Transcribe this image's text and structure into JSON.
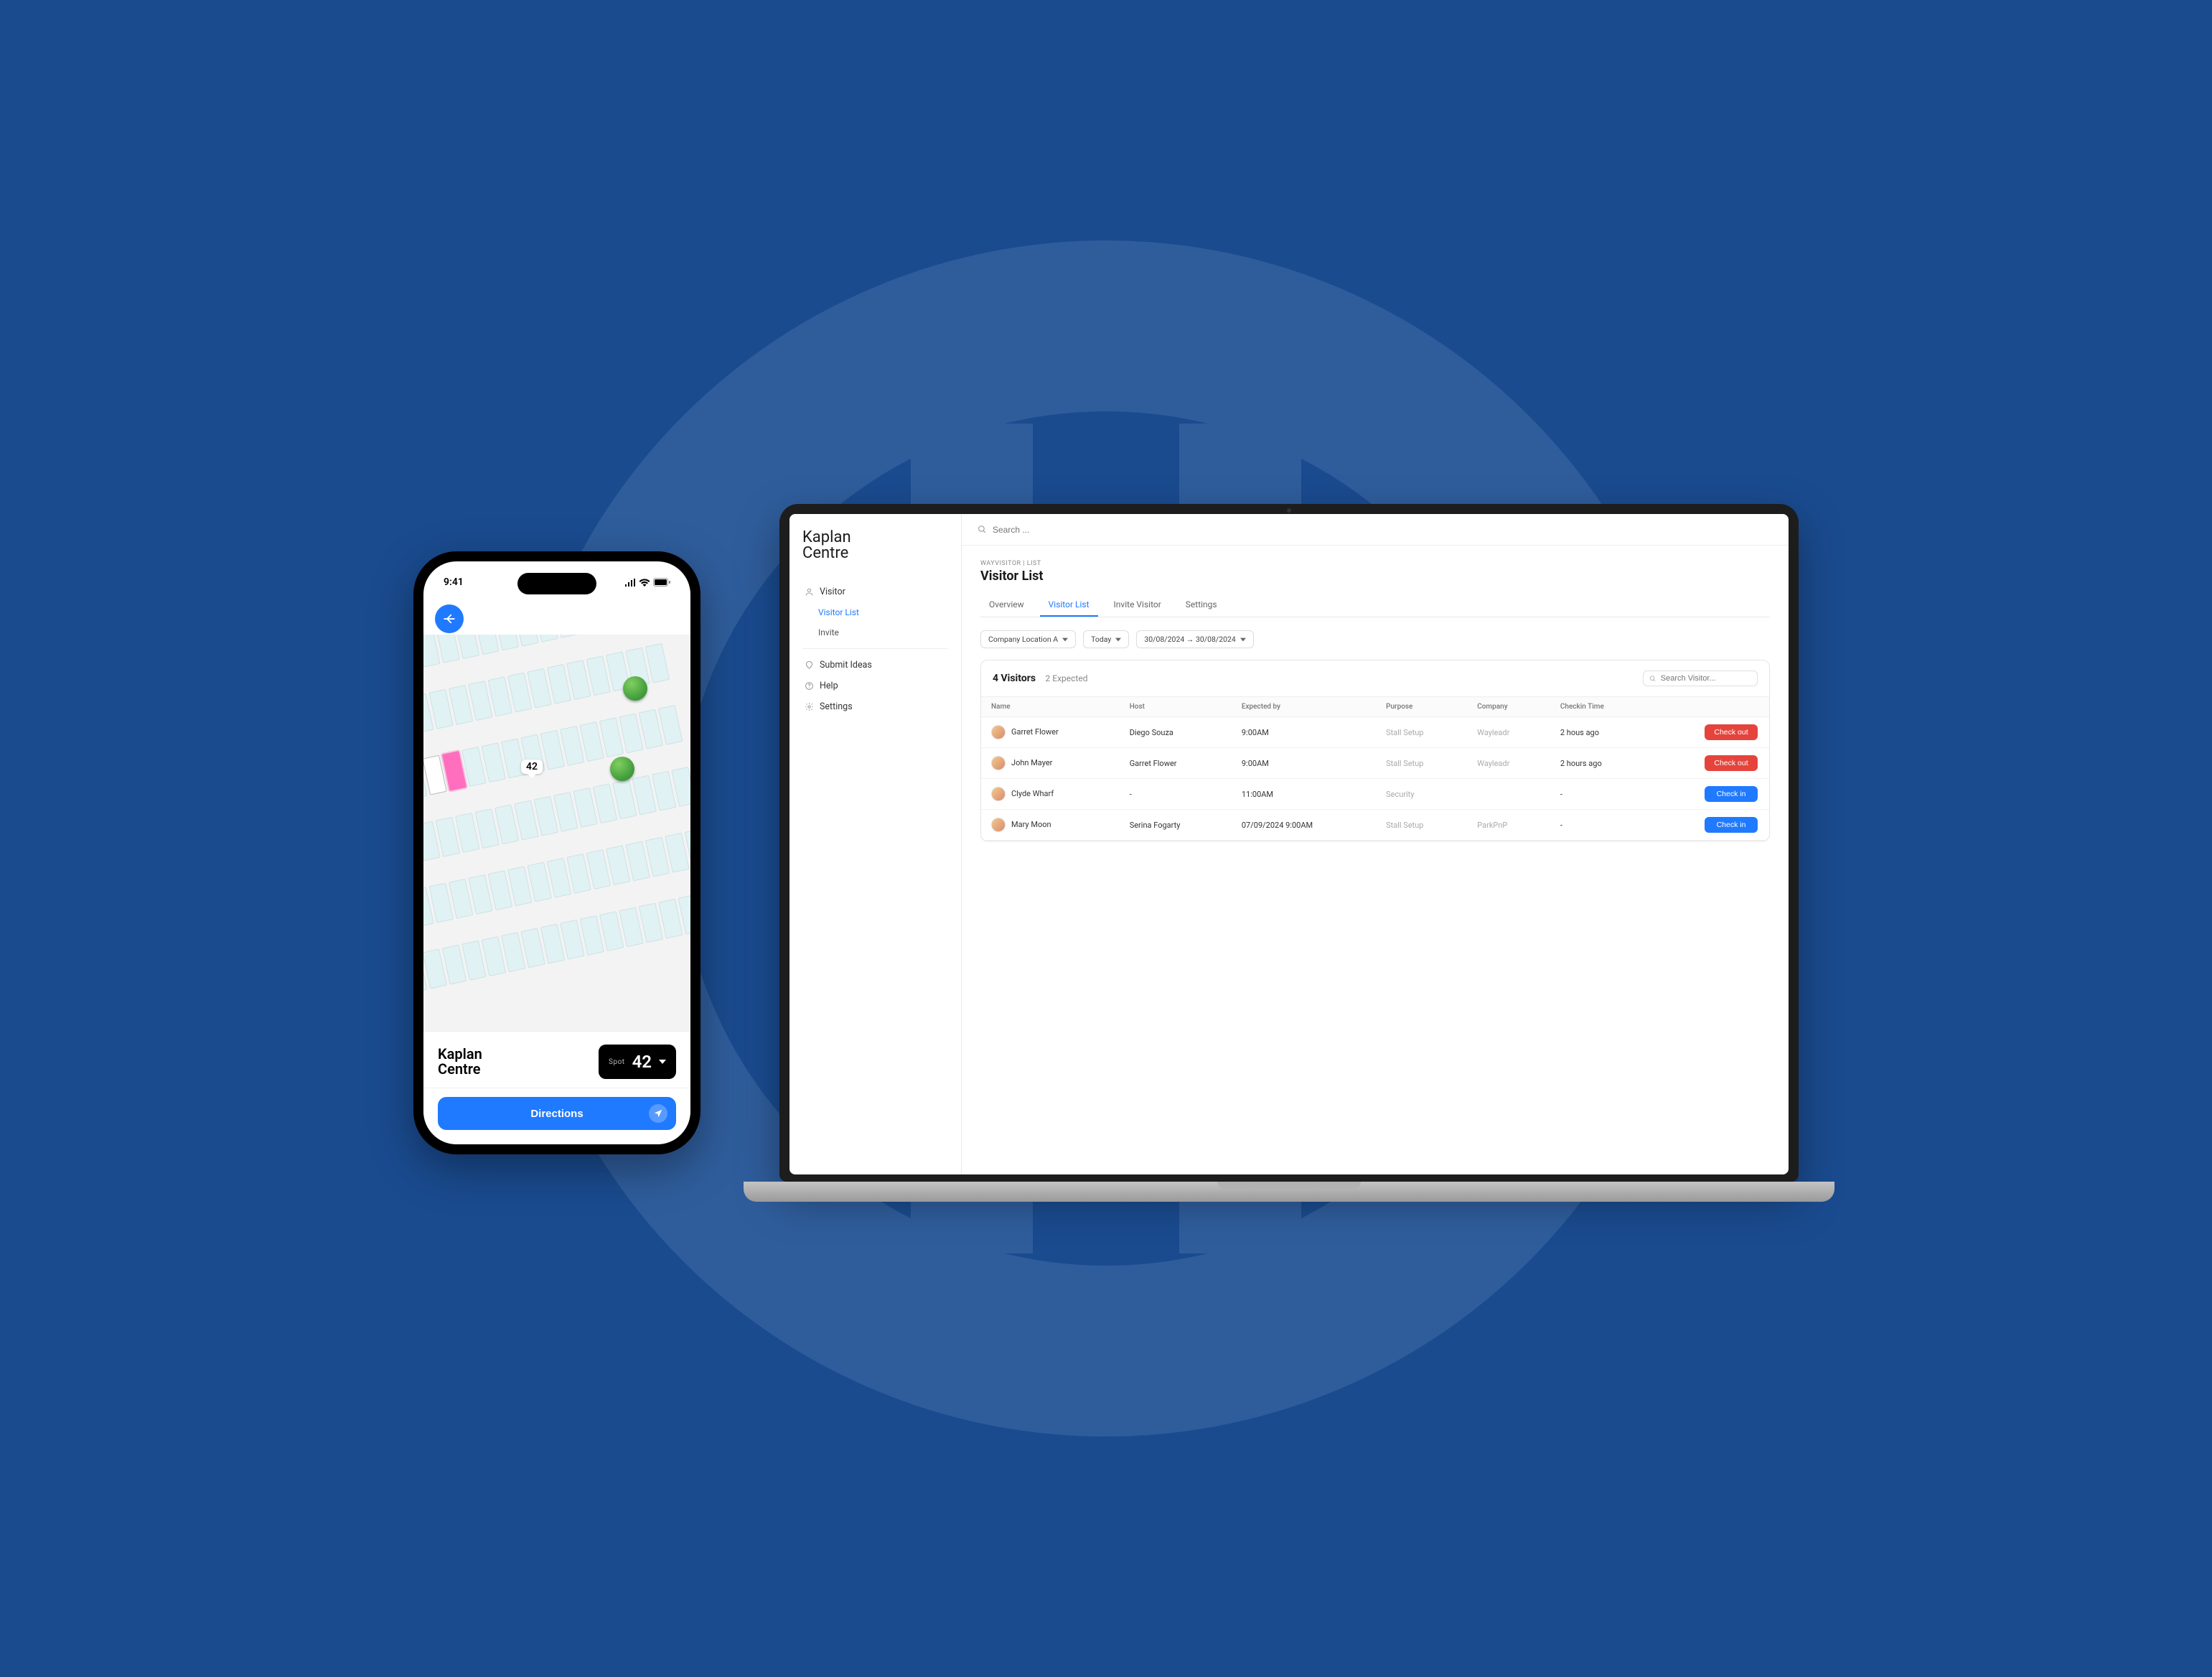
{
  "phone": {
    "status_time": "9:41",
    "title": "Kaplan\nCentre",
    "spot_label": "Spot",
    "spot_number": "42",
    "map_spot_number": "42",
    "directions_label": "Directions"
  },
  "laptop": {
    "brand": "Kaplan\nCentre",
    "search_placeholder": "Search ...",
    "sidebar": {
      "visitor": "Visitor",
      "visitor_list": "Visitor List",
      "invite": "Invite",
      "submit_ideas": "Submit Ideas",
      "help": "Help",
      "settings": "Settings"
    },
    "breadcrumb": "WAYVISITOR | List",
    "page_title": "Visitor List",
    "tabs": {
      "overview": "Overview",
      "visitor_list": "Visitor List",
      "invite_visitor": "Invite Visitor",
      "settings": "Settings"
    },
    "filters": {
      "location": "Company Location A",
      "period": "Today",
      "range": "30/08/2024 → 30/08/2024"
    },
    "panel": {
      "count": "4 Visitors",
      "expected": "2 Expected",
      "search_placeholder": "Search Visitor..."
    },
    "columns": {
      "name": "Name",
      "host": "Host",
      "expected": "Expected by",
      "purpose": "Purpose",
      "company": "Company",
      "checkin": "Checkin Time"
    },
    "rows": [
      {
        "name": "Garret Flower",
        "host": "Diego Souza",
        "expected": "9:00AM",
        "purpose": "Stall Setup",
        "company": "Wayleadr",
        "checkin": "2 hous ago",
        "action": "Check out",
        "action_style": "red"
      },
      {
        "name": "John Mayer",
        "host": "Garret Flower",
        "expected": "9:00AM",
        "purpose": "Stall Setup",
        "company": "Wayleadr",
        "checkin": "2 hours ago",
        "action": "Check out",
        "action_style": "red"
      },
      {
        "name": "Clyde Wharf",
        "host": "-",
        "expected": "11:00AM",
        "purpose": "Security",
        "company": "",
        "checkin": "-",
        "action": "Check in",
        "action_style": "blue"
      },
      {
        "name": "Mary Moon",
        "host": "Serina Fogarty",
        "expected": "07/09/2024 9:00AM",
        "purpose": "Stall Setup",
        "company": "ParkPnP",
        "checkin": "-",
        "action": "Check in",
        "action_style": "blue"
      }
    ]
  }
}
